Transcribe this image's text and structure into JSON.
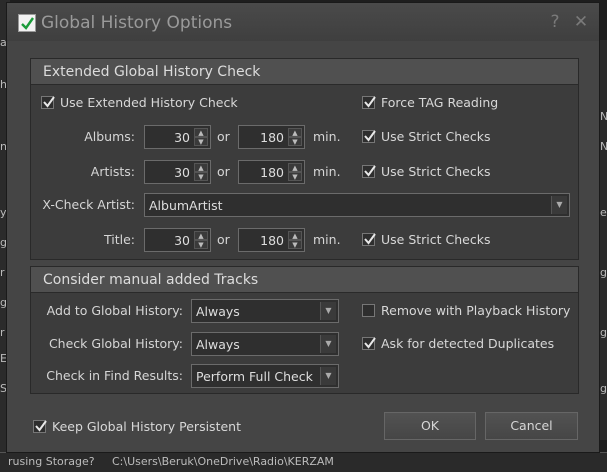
{
  "window": {
    "title": "Global History Options",
    "help_glyph": "?",
    "close_glyph": "✕"
  },
  "extended": {
    "title": "Extended Global History Check",
    "use_extended": {
      "label": "Use Extended History Check",
      "checked": true
    },
    "force_tag": {
      "label": "Force TAG Reading",
      "checked": true
    },
    "albums": {
      "label": "Albums:",
      "min_value": "30",
      "or": "or",
      "max_value": "180",
      "unit": "min.",
      "strict_label": "Use Strict Checks",
      "strict_checked": true
    },
    "artists": {
      "label": "Artists:",
      "min_value": "30",
      "or": "or",
      "max_value": "180",
      "unit": "min.",
      "strict_label": "Use Strict Checks",
      "strict_checked": true
    },
    "xcheck": {
      "label": "X-Check Artist:",
      "value": "AlbumArtist"
    },
    "title_row": {
      "label": "Title:",
      "min_value": "30",
      "or": "or",
      "max_value": "180",
      "unit": "min.",
      "strict_label": "Use Strict Checks",
      "strict_checked": true
    }
  },
  "manual": {
    "title": "Consider manual added Tracks",
    "add_global": {
      "label": "Add to Global History:",
      "value": "Always"
    },
    "check_global": {
      "label": "Check Global History:",
      "value": "Always"
    },
    "find_results": {
      "label": "Check in Find Results:",
      "value": "Perform Full Check"
    },
    "remove_playback": {
      "label": "Remove with Playback History",
      "checked": false
    },
    "ask_duplicates": {
      "label": "Ask for detected Duplicates",
      "checked": true
    }
  },
  "footer": {
    "keep_persistent": {
      "label": "Keep Global History Persistent",
      "checked": true
    },
    "ok_label": "OK",
    "cancel_label": "Cancel"
  },
  "background": {
    "bottom_left": "rusing Storage?",
    "bottom_path": "C:\\Users\\Beruk\\OneDrive\\Radio\\KERZAM",
    "left_fragments": [
      "ab",
      "h",
      "ne",
      "y",
      "g",
      "r",
      "g",
      "r",
      "E",
      "S"
    ],
    "right_fragments": [
      "N",
      "N",
      "e",
      "g",
      "g",
      "g"
    ]
  },
  "colors": {
    "dialog_bg": "#454545",
    "group_bg": "#3c3c3c",
    "header_bg": "#505050",
    "text": "#d8d8d8"
  }
}
